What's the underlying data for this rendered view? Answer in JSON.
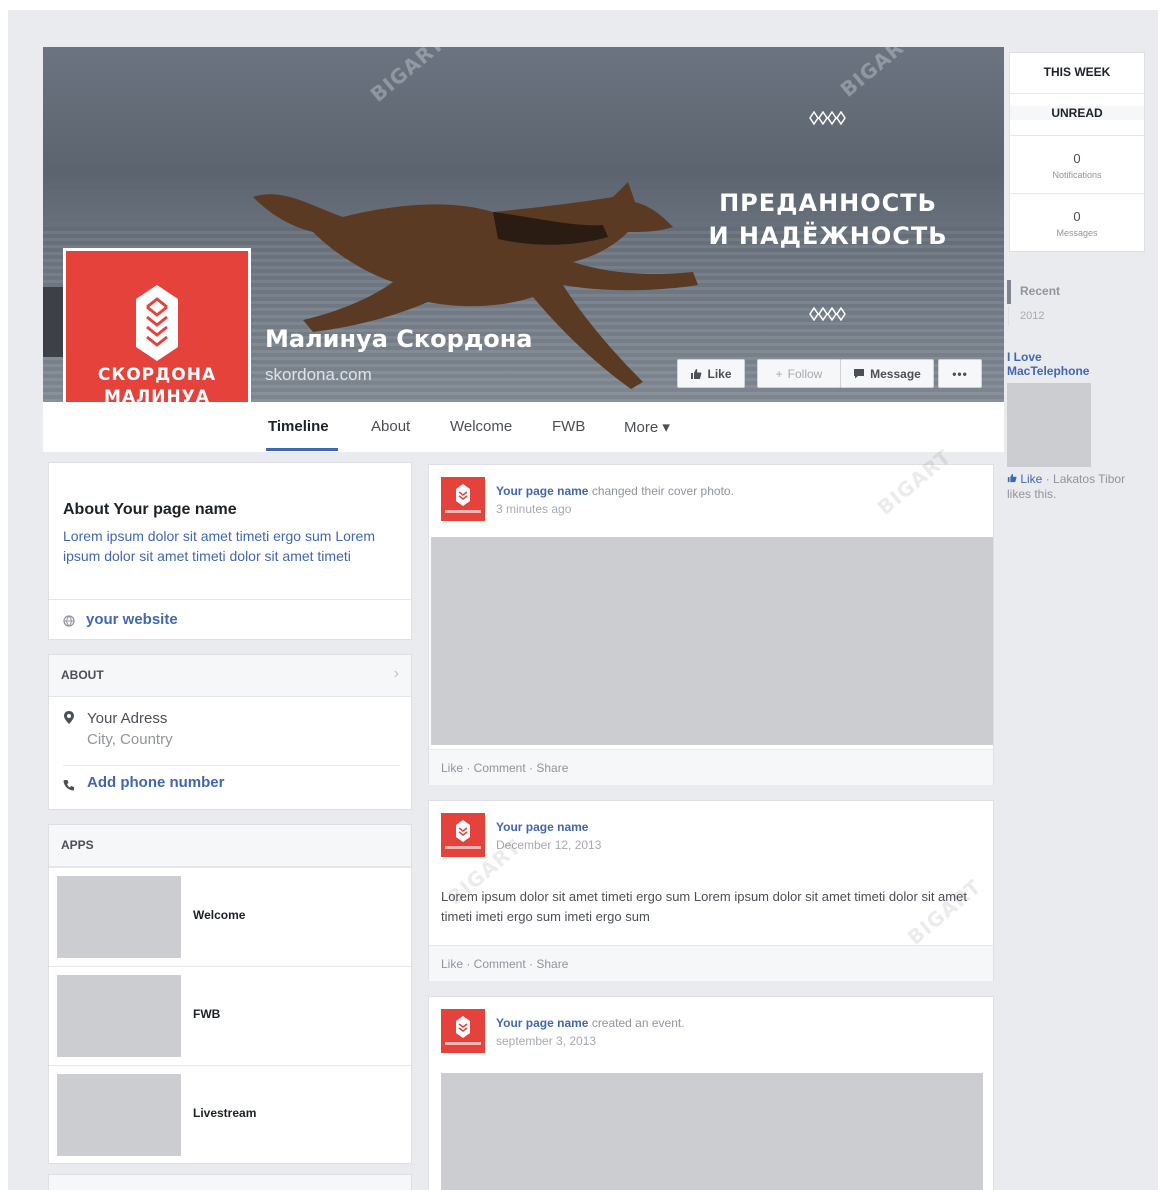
{
  "cover": {
    "slogan_line1": "ПРЕДАННОСТЬ",
    "slogan_line2": "И НАДЁЖНОСТЬ",
    "page_title": "Малинуа Скордона",
    "page_url": "skordona.com",
    "buttons": {
      "like": "Like",
      "follow": "Follow",
      "message": "Message",
      "more": "•••"
    },
    "watermark": "BIGART"
  },
  "logo": {
    "line1": "СКОРДОНА",
    "line2": "МАЛИНУА",
    "color": "#e4423a"
  },
  "nav": {
    "tabs": [
      "Timeline",
      "About",
      "Welcome",
      "FWB",
      "More ▾"
    ]
  },
  "about": {
    "title": "About Your page name",
    "description": "Lorem ipsum dolor sit amet timeti ergo sum Lorem ipsum dolor sit amet timeti dolor sit amet timeti",
    "website": "your website"
  },
  "about_section": {
    "header": "ABOUT",
    "address": "Your Adress",
    "city": "City, Country",
    "phone": "Add phone number"
  },
  "apps": {
    "header": "APPS",
    "items": [
      "Welcome",
      "FWB",
      "Livestream"
    ]
  },
  "posts": [
    {
      "name": "Your page name",
      "action": "changed their cover photo.",
      "time": "3 minutes ago",
      "actions": "Like · Comment · Share"
    },
    {
      "name": "Your page name",
      "action": "",
      "time": "December 12, 2013",
      "text": "Lorem ipsum dolor sit amet timeti ergo sum Lorem ipsum dolor sit amet timeti dolor sit amet timeti imeti ergo sum imeti ergo sum",
      "actions": "Like · Comment · Share"
    },
    {
      "name": "Your page name",
      "action": "created an event.",
      "time": "september 3, 2013"
    }
  ],
  "sidebar": {
    "this_week": "THIS WEEK",
    "unread": "UNREAD",
    "notifications_count": "0",
    "notifications_label": "Notifications",
    "messages_count": "0",
    "messages_label": "Messages",
    "recent": "Recent",
    "year": "2012",
    "fan_page": "I Love MacTelephone",
    "like_text": "Like",
    "like_by": "· Lakatos Tibor likes this."
  },
  "colors": {
    "brand_red": "#e4423a",
    "link_blue": "#4267b2",
    "background": "#e9ebee"
  }
}
